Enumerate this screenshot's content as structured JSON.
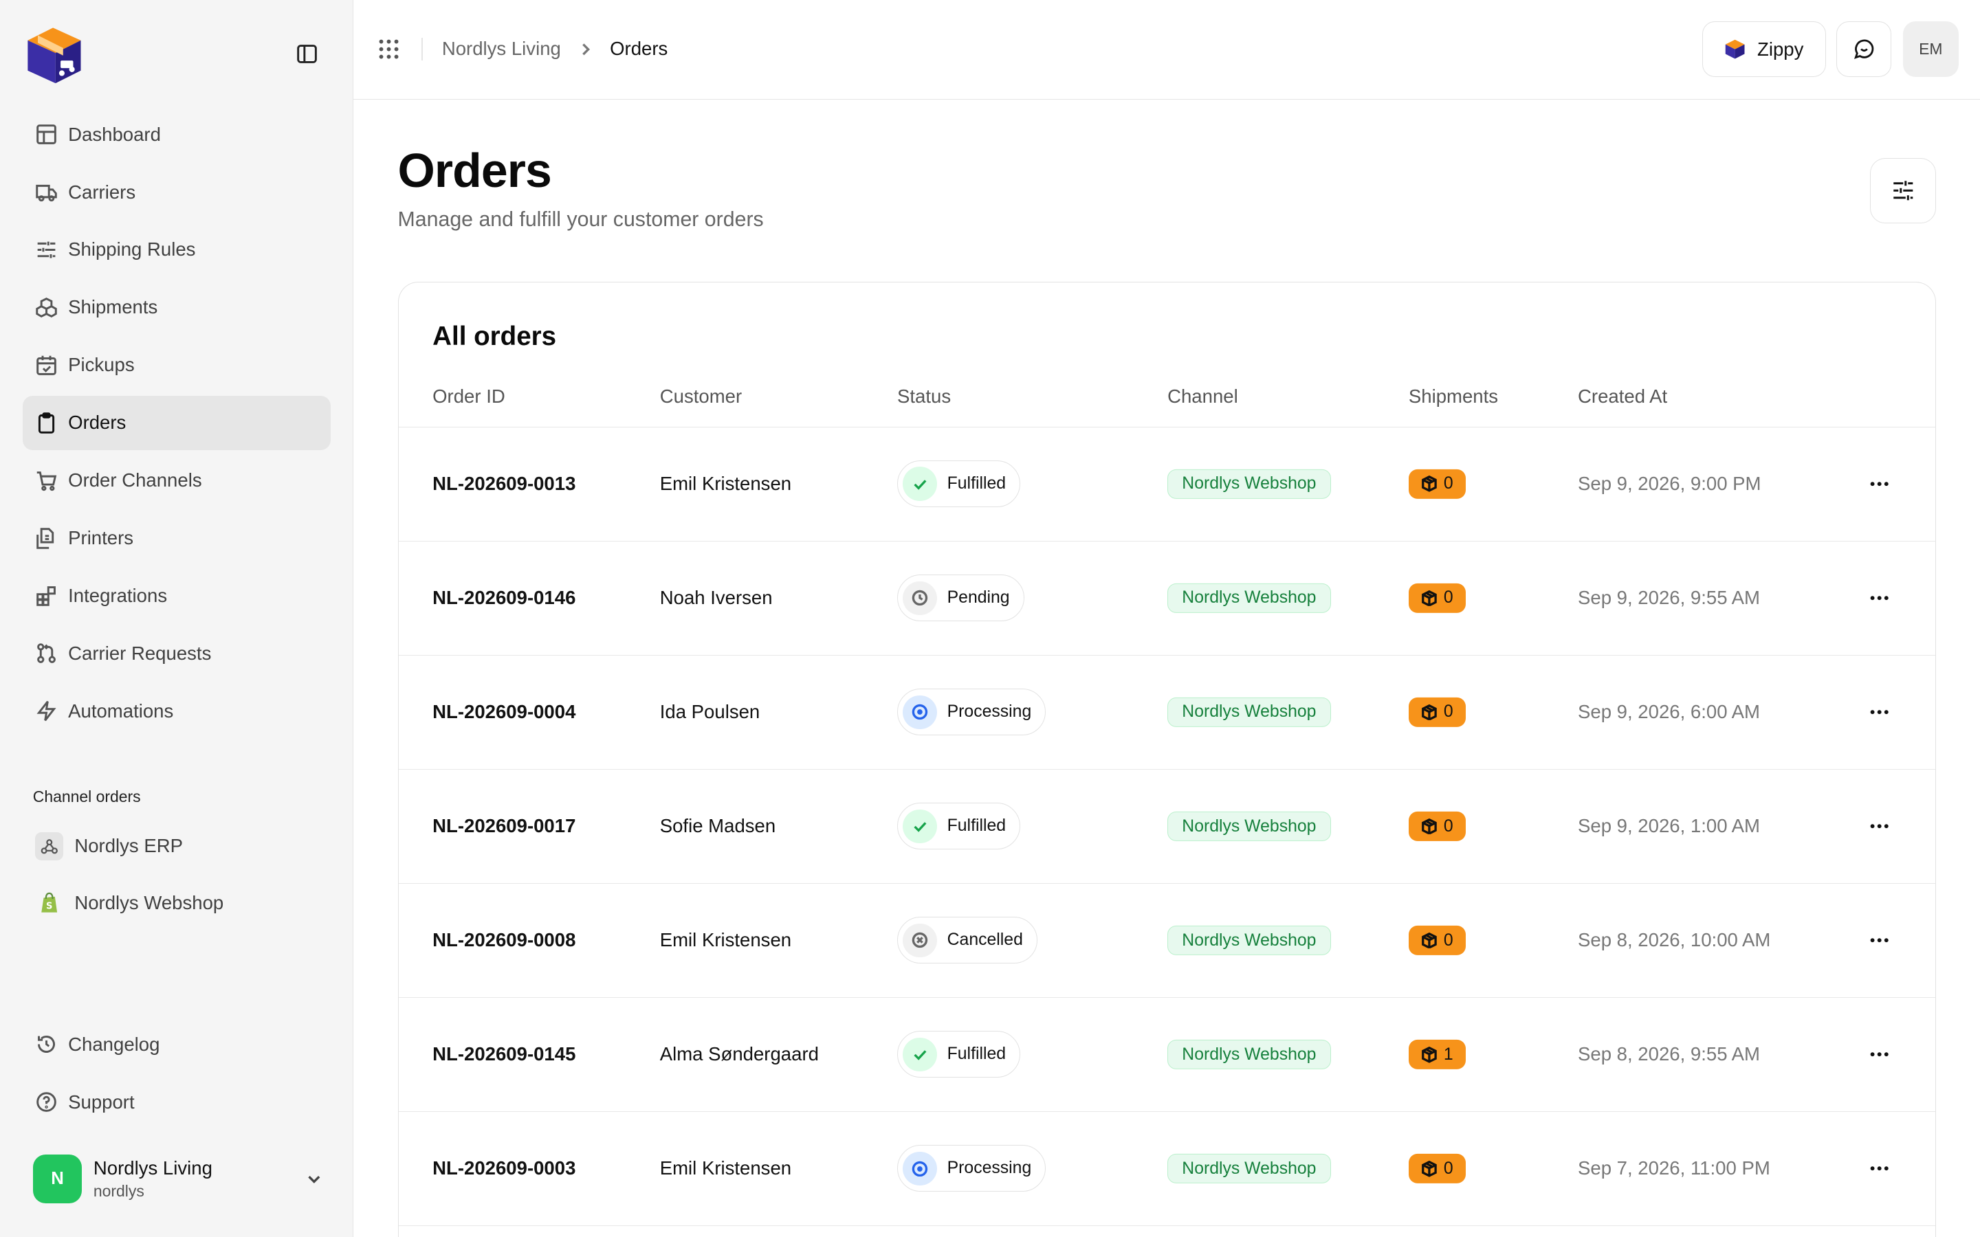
{
  "sidebar": {
    "nav": [
      {
        "label": "Dashboard",
        "icon": "dashboard-icon",
        "active": false
      },
      {
        "label": "Carriers",
        "icon": "truck-icon",
        "active": false
      },
      {
        "label": "Shipping Rules",
        "icon": "sliders-icon",
        "active": false
      },
      {
        "label": "Shipments",
        "icon": "boxes-icon",
        "active": false
      },
      {
        "label": "Pickups",
        "icon": "calendar-check-icon",
        "active": false
      },
      {
        "label": "Orders",
        "icon": "clipboard-icon",
        "active": true
      },
      {
        "label": "Order Channels",
        "icon": "cart-icon",
        "active": false
      },
      {
        "label": "Printers",
        "icon": "printer-icon",
        "active": false
      },
      {
        "label": "Integrations",
        "icon": "blocks-icon",
        "active": false
      },
      {
        "label": "Carrier Requests",
        "icon": "git-pull-request-icon",
        "active": false
      },
      {
        "label": "Automations",
        "icon": "zap-icon",
        "active": false
      }
    ],
    "channel_section_label": "Channel orders",
    "channels": [
      {
        "label": "Nordlys ERP",
        "icon": "webhook-icon"
      },
      {
        "label": "Nordlys Webshop",
        "icon": "shopify-icon"
      }
    ],
    "bottom_nav": [
      {
        "label": "Changelog",
        "icon": "history-icon"
      },
      {
        "label": "Support",
        "icon": "help-circle-icon"
      }
    ],
    "user": {
      "initial": "N",
      "name": "Nordlys Living",
      "handle": "nordlys"
    }
  },
  "topbar": {
    "breadcrumb": [
      "Nordlys Living",
      "Orders"
    ],
    "zippy_label": "Zippy",
    "avatar_initials": "EM"
  },
  "page": {
    "title": "Orders",
    "subtitle": "Manage and fulfill your customer orders"
  },
  "table": {
    "title": "All orders",
    "columns": [
      "Order ID",
      "Customer",
      "Status",
      "Channel",
      "Shipments",
      "Created At"
    ],
    "rows": [
      {
        "id": "NL-202609-0013",
        "customer": "Emil Kristensen",
        "status": "Fulfilled",
        "channel": "Nordlys Webshop",
        "shipments": "0",
        "created": "Sep 9, 2026, 9:00 PM"
      },
      {
        "id": "NL-202609-0146",
        "customer": "Noah Iversen",
        "status": "Pending",
        "channel": "Nordlys Webshop",
        "shipments": "0",
        "created": "Sep 9, 2026, 9:55 AM"
      },
      {
        "id": "NL-202609-0004",
        "customer": "Ida Poulsen",
        "status": "Processing",
        "channel": "Nordlys Webshop",
        "shipments": "0",
        "created": "Sep 9, 2026, 6:00 AM"
      },
      {
        "id": "NL-202609-0017",
        "customer": "Sofie Madsen",
        "status": "Fulfilled",
        "channel": "Nordlys Webshop",
        "shipments": "0",
        "created": "Sep 9, 2026, 1:00 AM"
      },
      {
        "id": "NL-202609-0008",
        "customer": "Emil Kristensen",
        "status": "Cancelled",
        "channel": "Nordlys Webshop",
        "shipments": "0",
        "created": "Sep 8, 2026, 10:00 AM"
      },
      {
        "id": "NL-202609-0145",
        "customer": "Alma Søndergaard",
        "status": "Fulfilled",
        "channel": "Nordlys Webshop",
        "shipments": "1",
        "created": "Sep 8, 2026, 9:55 AM"
      },
      {
        "id": "NL-202609-0003",
        "customer": "Emil Kristensen",
        "status": "Processing",
        "channel": "Nordlys Webshop",
        "shipments": "0",
        "created": "Sep 7, 2026, 11:00 PM"
      }
    ]
  },
  "colors": {
    "accent_orange": "#f7931a",
    "success_green": "#22c55e",
    "channel_badge_bg": "#e7f9ee",
    "channel_badge_text": "#16803c",
    "processing_blue": "#2563eb"
  }
}
